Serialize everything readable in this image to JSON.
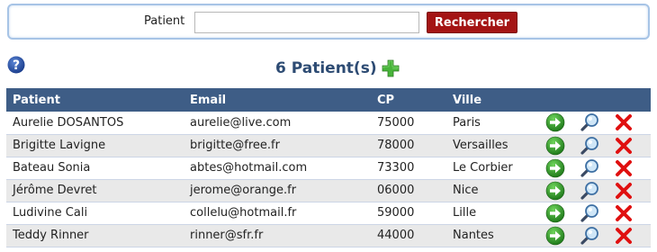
{
  "search": {
    "label": "Patient",
    "value": "",
    "placeholder": "",
    "button_label": "Rechercher"
  },
  "summary": {
    "count_title": "6 Patient(s)"
  },
  "table": {
    "columns": [
      "Patient",
      "Email",
      "CP",
      "Ville"
    ],
    "rows": [
      {
        "name": "Aurelie DOSANTOS",
        "email": "aurelie@live.com",
        "cp": "75000",
        "ville": "Paris"
      },
      {
        "name": "Brigitte Lavigne",
        "email": "brigitte@free.fr",
        "cp": "78000",
        "ville": "Versailles"
      },
      {
        "name": "Bateau Sonia",
        "email": "abtes@hotmail.com",
        "cp": "73300",
        "ville": "Le Corbier"
      },
      {
        "name": "Jérôme Devret",
        "email": "jerome@orange.fr",
        "cp": "06000",
        "ville": "Nice"
      },
      {
        "name": "Ludivine Cali",
        "email": "collelu@hotmail.fr",
        "cp": "59000",
        "ville": "Lille"
      },
      {
        "name": "Teddy Rinner",
        "email": "rinner@sfr.fr",
        "cp": "44000",
        "ville": "Nantes"
      }
    ]
  },
  "icons": {
    "help": "help-icon",
    "add": "plus-icon",
    "open": "arrow-right-icon",
    "view": "magnifier-icon",
    "delete": "close-icon"
  },
  "colors": {
    "header_bg": "#3e5d86",
    "button_bg": "#a41414",
    "title": "#2d4b73",
    "row_alt": "#e9e9e9"
  }
}
